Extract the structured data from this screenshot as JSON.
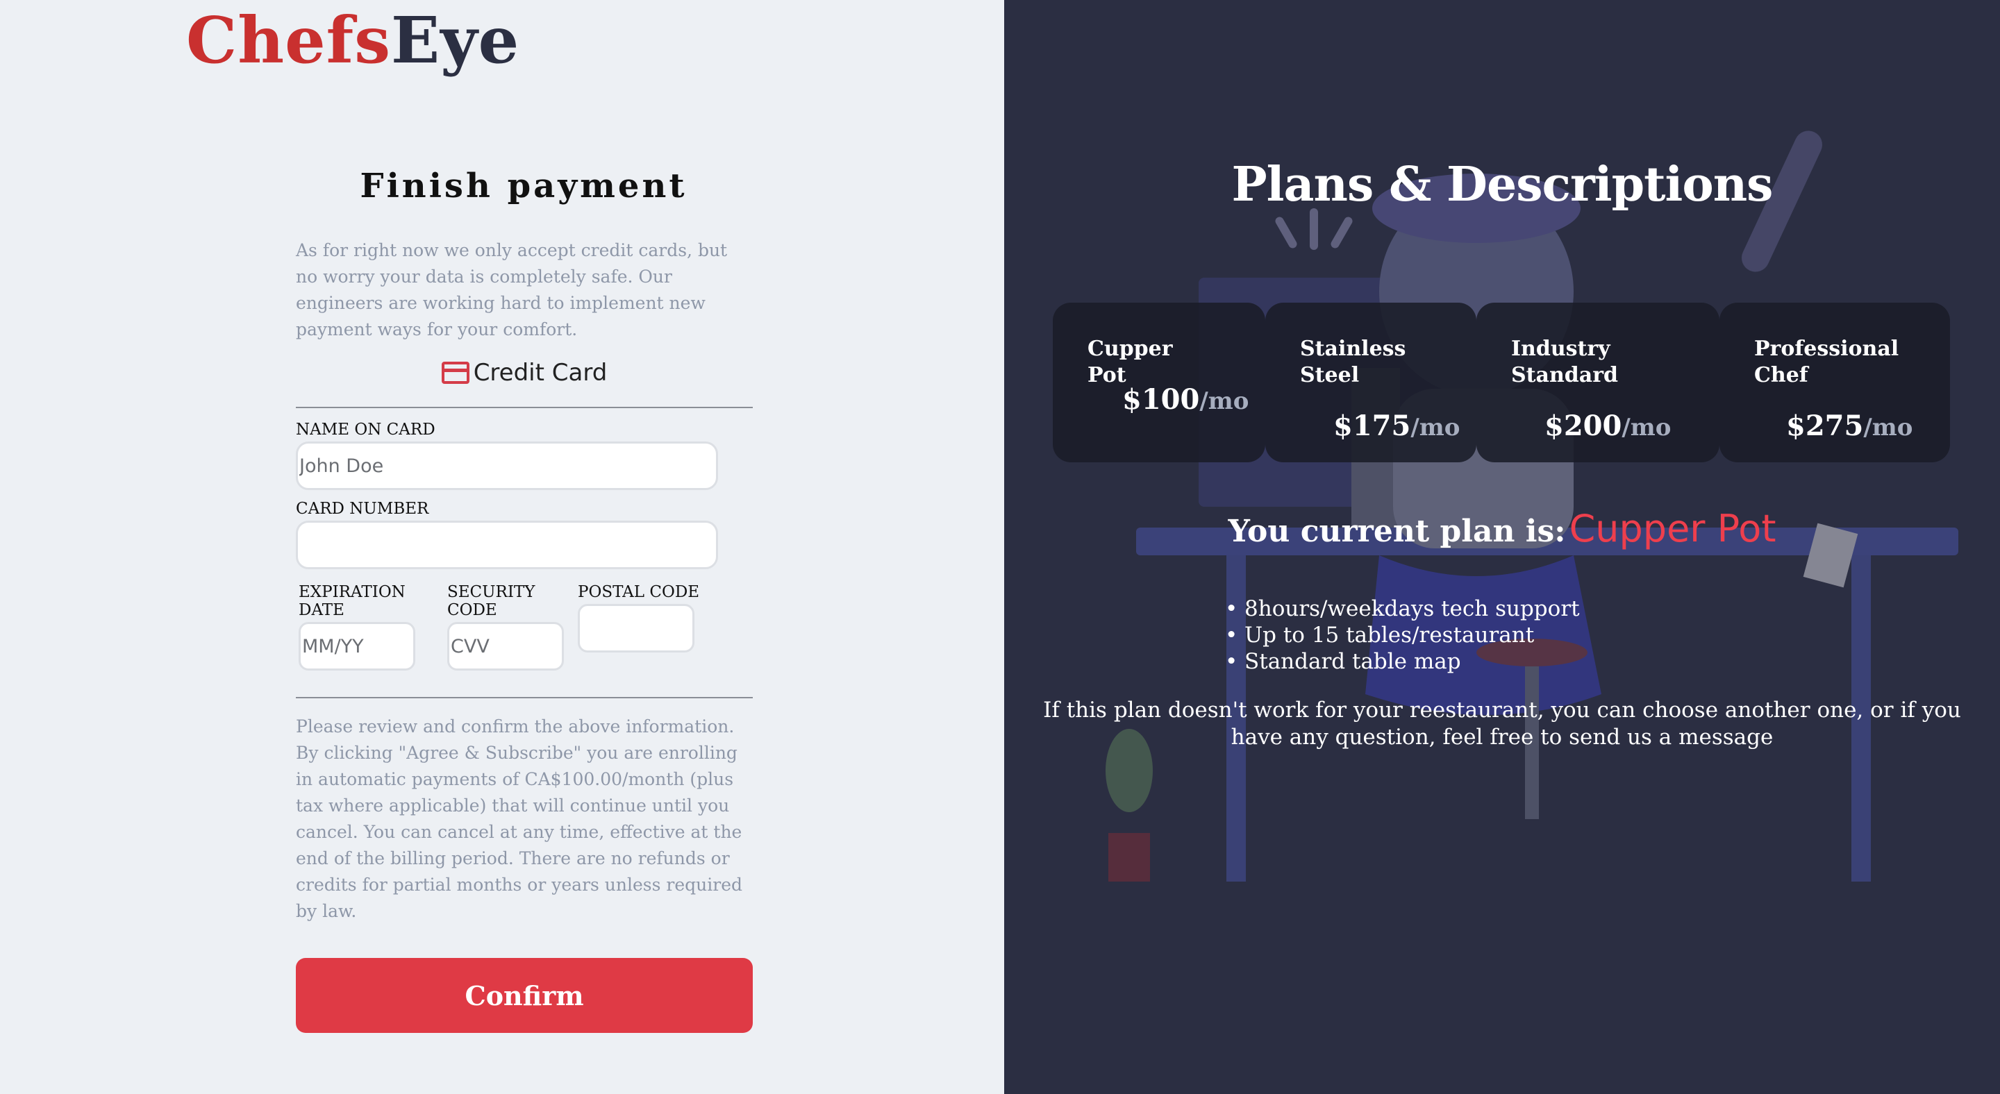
{
  "logo": {
    "part1": "Chefs",
    "part2": "Eye"
  },
  "payment": {
    "title": "Finish payment",
    "intro": "As for right now we only accept credit cards, but no worry your data is completely safe. Our engineers are working hard to implement new payment ways for your comfort.",
    "method_icon": "credit-card-icon",
    "method_label": "Credit Card",
    "fields": {
      "name_label": "NAME ON CARD",
      "name_placeholder": "John Doe",
      "name_value": "",
      "number_label": "CARD NUMBER",
      "number_placeholder": "",
      "number_value": "",
      "exp_label": "EXPIRATION DATE",
      "exp_placeholder": "MM/YY",
      "cvv_label": "SECURITY CODE",
      "cvv_placeholder": "CVV",
      "postal_label": "POSTAL CODE",
      "postal_placeholder": ""
    },
    "legal": "Please review and confirm the above information. By clicking \"Agree & Subscribe\" you are enrolling in automatic payments of CA$100.00/month (plus tax where applicable) that will continue until you cancel. You can cancel at any time, effective at the end of the billing period. There are no refunds or credits for partial months or years unless required by law.",
    "confirm_label": "Confirm"
  },
  "plans_panel": {
    "title": "Plans & Descriptions",
    "per": "/mo",
    "plans": [
      {
        "name": "Cupper Pot",
        "price": "$100"
      },
      {
        "name": "Stainless Steel",
        "price": "$175"
      },
      {
        "name": "Industry Standard",
        "price": "$200"
      },
      {
        "name": "Professional Chef",
        "price": "$275"
      }
    ],
    "current_label": "You current plan is:",
    "current_value": "Cupper Pot",
    "features": [
      "8hours/weekdays tech support",
      "Up to 15 tables/restaurant",
      "Standard table map"
    ],
    "note": "If this plan doesn't work for your reestaurant, you can choose another one, or if you have any question, feel free to send us a message"
  },
  "colors": {
    "brand_red": "#c9302f",
    "brand_dark": "#2b2f42",
    "confirm_button": "#df3a45",
    "right_bg": "#2b2e42",
    "current_plan_accent": "#ee3f4d"
  }
}
